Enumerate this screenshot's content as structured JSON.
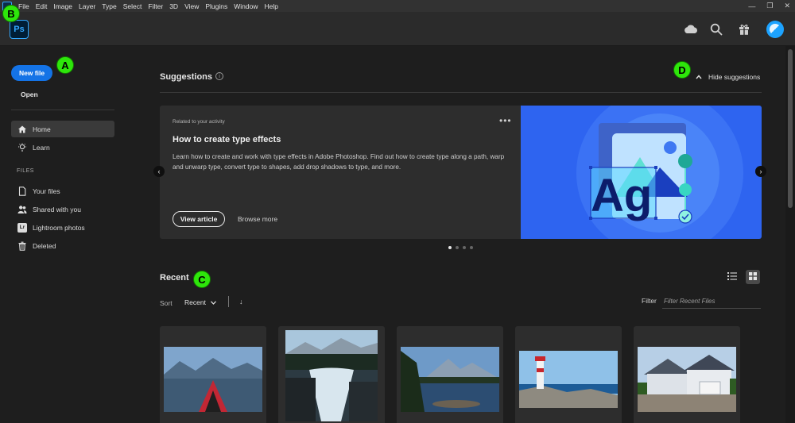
{
  "menubar": {
    "items": [
      "File",
      "Edit",
      "Image",
      "Layer",
      "Type",
      "Select",
      "Filter",
      "3D",
      "View",
      "Plugins",
      "Window",
      "Help"
    ]
  },
  "header": {
    "logo": "Ps"
  },
  "sidebar": {
    "new_file": "New file",
    "open": "Open",
    "nav": [
      {
        "label": "Home",
        "icon": "home-icon",
        "active": true
      },
      {
        "label": "Learn",
        "icon": "lightbulb-icon"
      }
    ],
    "files_heading": "FILES",
    "files": [
      {
        "label": "Your files",
        "icon": "file-icon"
      },
      {
        "label": "Shared with you",
        "icon": "people-icon"
      },
      {
        "label": "Lightroom photos",
        "icon": "lightroom-icon",
        "glyph": "Lr"
      },
      {
        "label": "Deleted",
        "icon": "trash-icon"
      }
    ]
  },
  "suggestions": {
    "title": "Suggestions",
    "hide": "Hide suggestions",
    "card": {
      "eyebrow": "Related to your activity",
      "title": "How to create type effects",
      "description": "Learn how to create and work with type effects in Adobe Photoshop. Find out how to create type along a path, warp and unwarp type, convert type to shapes, add drop shadows to type, and more.",
      "primary": "View article",
      "secondary": "Browse more",
      "art_text": "Ag"
    },
    "page_count": 4,
    "current_page": 1
  },
  "recent": {
    "title": "Recent",
    "sort_label": "Sort",
    "sort_value": "Recent",
    "filter_label": "Filter",
    "filter_placeholder": "Filter Recent Files"
  },
  "annotations": [
    "A",
    "B",
    "C",
    "D"
  ],
  "colors": {
    "accent": "#1473e6",
    "badge": "#2ee60b",
    "card_art": "#2e64f0"
  }
}
